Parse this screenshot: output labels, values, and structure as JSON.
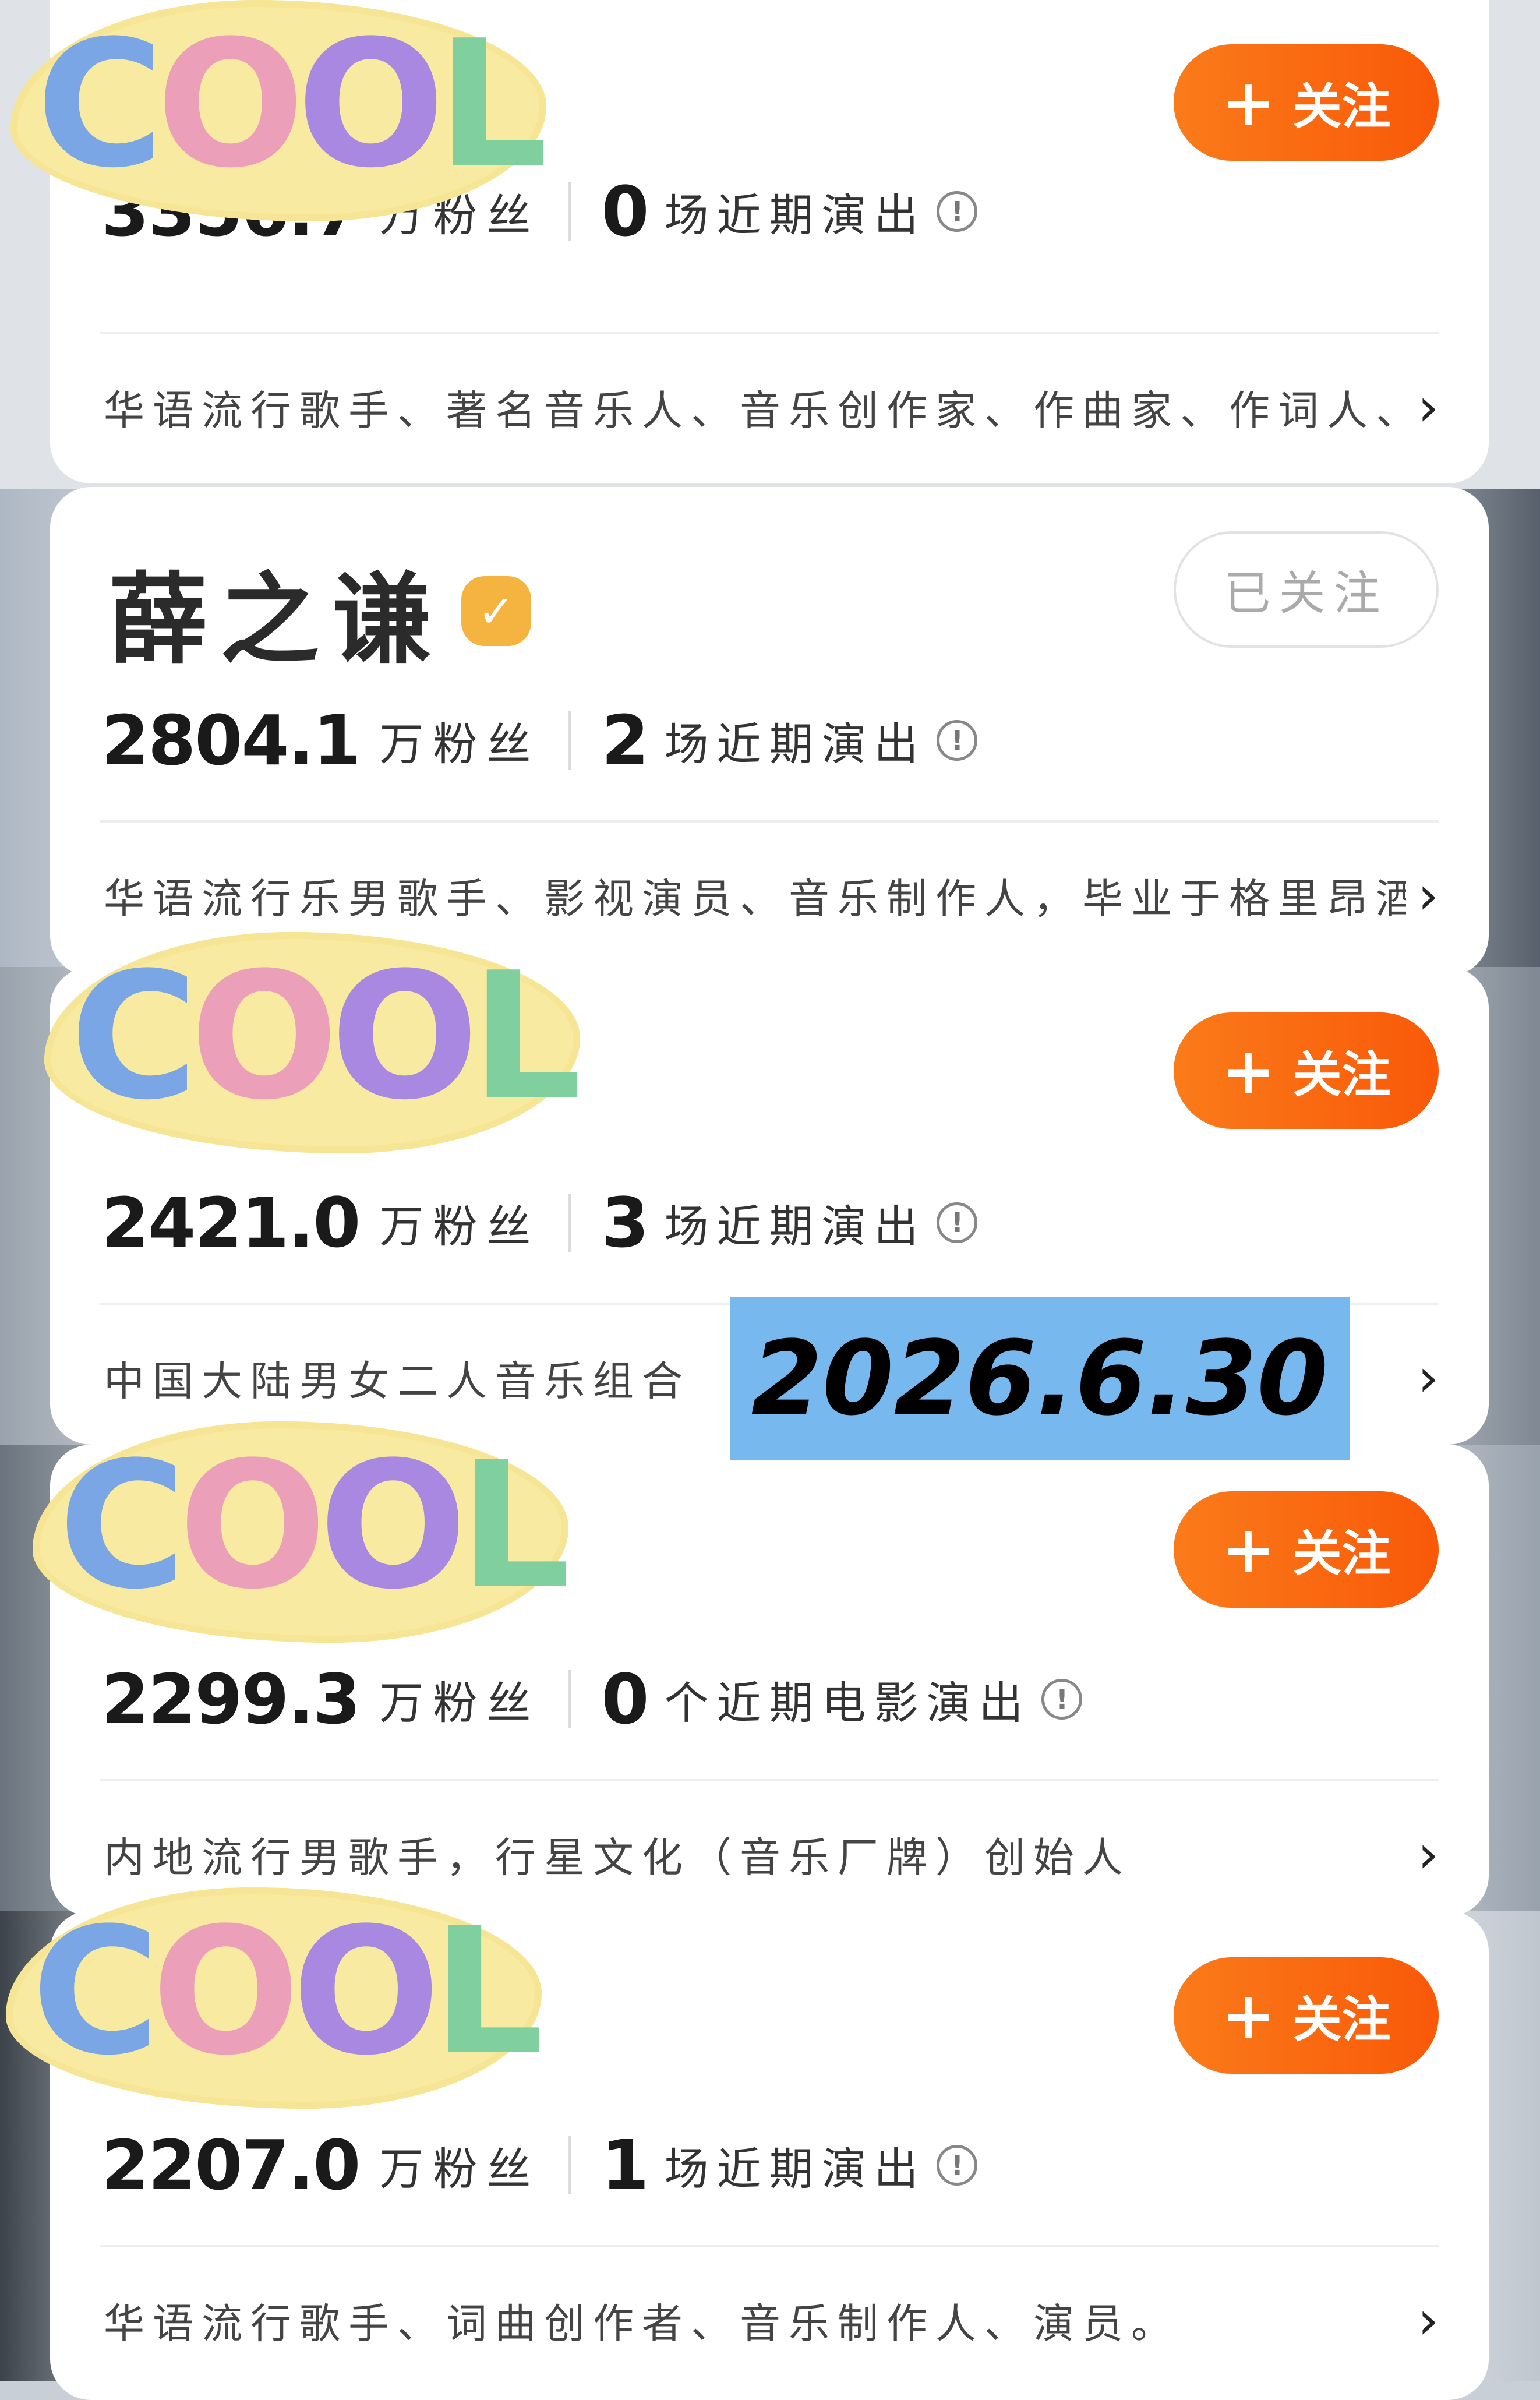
{
  "accent_color": "#f96a0f",
  "cards": [
    {
      "name": "",
      "follow_label": "关注",
      "fans": "3356.7",
      "fans_unit": "万粉丝",
      "shows": "0",
      "shows_label": "场近期演出",
      "description": "华语流行歌手、著名音乐人、音乐创作家、作曲家、作词人、制"
    },
    {
      "name": "薛之谦",
      "follow_label": "已关注",
      "fans": "2804.1",
      "fans_unit": "万粉丝",
      "shows": "2",
      "shows_label": "场近期演出",
      "description": "华语流行乐男歌手、影视演员、音乐制作人，毕业于格里昂酒店"
    },
    {
      "name": "",
      "follow_label": "关注",
      "fans": "2421.0",
      "fans_unit": "万粉丝",
      "shows": "3",
      "shows_label": "场近期演出",
      "description": "中国大陆男女二人音乐组合"
    },
    {
      "name": "",
      "follow_label": "关注",
      "fans": "2299.3",
      "fans_unit": "万粉丝",
      "shows": "0",
      "shows_label": "个近期电影演出",
      "description": "内地流行男歌手，行星文化（音乐厂牌）创始人"
    },
    {
      "name": "",
      "follow_label": "关注",
      "fans": "2207.0",
      "fans_unit": "万粉丝",
      "shows": "1",
      "shows_label": "场近期演出",
      "description": "华语流行歌手、词曲创作者、音乐制作人、演员。"
    }
  ],
  "sticker_text": "COOL",
  "date_stamp": "2026.6.30"
}
